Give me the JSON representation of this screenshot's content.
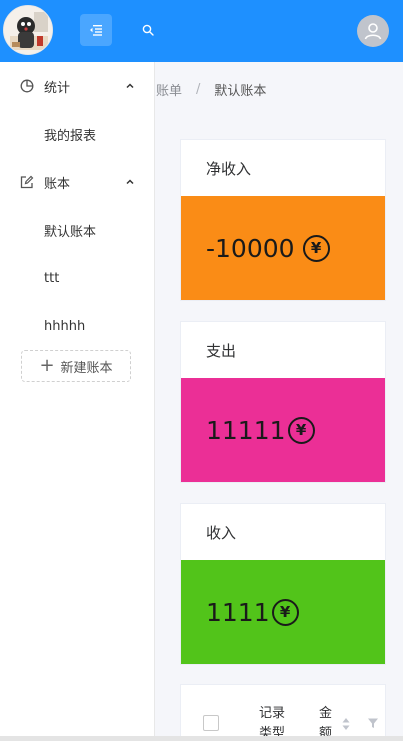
{
  "header": {
    "logo_icon": "logo-avatar-icon",
    "collapse_icon": "menu-fold-icon",
    "search_icon": "search-icon",
    "user_icon": "user-avatar-icon",
    "accent_color": "#1e90ff"
  },
  "sidebar": {
    "groups": [
      {
        "label": "统计",
        "icon": "pie-chart-icon",
        "expanded": true,
        "items": [
          {
            "label": "我的报表"
          }
        ]
      },
      {
        "label": "账本",
        "icon": "edit-icon",
        "expanded": true,
        "items": [
          {
            "label": "默认账本"
          },
          {
            "label": "ttt"
          },
          {
            "label": "hhhhh"
          }
        ]
      }
    ],
    "new_book_label": "新建账本"
  },
  "breadcrumb": {
    "parent": "账单",
    "separator": "/",
    "current": "默认账本"
  },
  "cards": [
    {
      "title": "净收入",
      "value": "-10000",
      "currency": "¥",
      "color": "#fa8c16"
    },
    {
      "title": "支出",
      "value": "11111",
      "currency": "¥",
      "color": "#eb2f96"
    },
    {
      "title": "收入",
      "value": "1111",
      "currency": "¥",
      "color": "#52c41a"
    }
  ],
  "table": {
    "columns": [
      {
        "label": "记录类型"
      },
      {
        "label": "金额"
      }
    ]
  }
}
